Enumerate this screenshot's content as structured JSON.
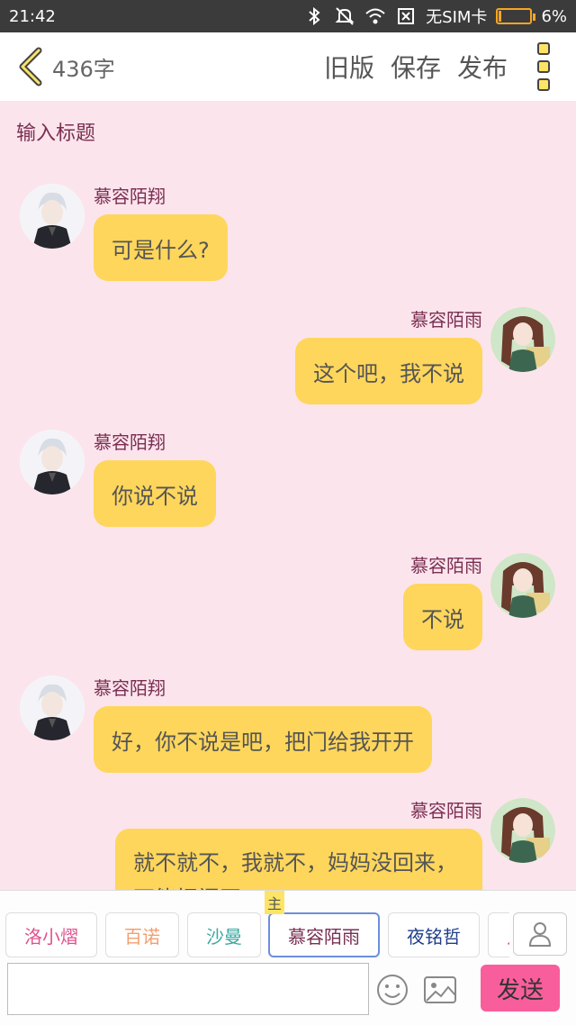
{
  "status_bar": {
    "time": "21:42",
    "sim_text": "无SIM卡",
    "battery_percent": "6%",
    "battery_level": 0.06,
    "icons": [
      "bluetooth-icon",
      "mute-icon",
      "wifi-icon",
      "no-sim-icon",
      "battery-icon"
    ]
  },
  "header": {
    "word_count": "436字",
    "actions": [
      "旧版",
      "保存",
      "发布"
    ]
  },
  "title_placeholder": "输入标题",
  "messages": [
    {
      "side": "left",
      "name": "慕容陌翔",
      "text": "可是什么?"
    },
    {
      "side": "right",
      "name": "慕容陌雨",
      "text": "这个吧，我不说"
    },
    {
      "side": "left",
      "name": "慕容陌翔",
      "text": "你说不说"
    },
    {
      "side": "right",
      "name": "慕容陌雨",
      "text": "不说"
    },
    {
      "side": "left",
      "name": "慕容陌翔",
      "text": "好，你不说是吧，把门给我开开"
    },
    {
      "side": "right",
      "name": "慕容陌雨",
      "text": "就不就不，我就不，妈妈没回来，不能把门开"
    }
  ],
  "roles": [
    {
      "label": "洛小熠",
      "color": "#e0518e"
    },
    {
      "label": "百诺",
      "color": "#f0a070"
    },
    {
      "label": "沙曼",
      "color": "#3aa8a0"
    },
    {
      "label": "慕容陌雨",
      "color": "#7a2f52",
      "active": true
    },
    {
      "label": "夜铭哲",
      "color": "#1f3e8a"
    },
    {
      "label": "几",
      "color": "#e0518e"
    }
  ],
  "main_badge": "主",
  "send_label": "发送",
  "colors": {
    "bubble": "#fed65c",
    "background": "#fce4ec",
    "name": "#7a2f52",
    "send_button": "#f95e9c",
    "accent": "#fde466"
  }
}
